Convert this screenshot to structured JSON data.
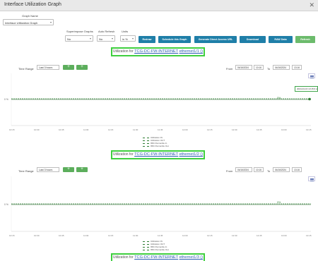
{
  "window": {
    "title": "Interface Utilization Graph",
    "close_glyph": "✕"
  },
  "controls": {
    "graph_name_label": "Graph Name",
    "graph_name_value": "Interface Utilization Graph",
    "superimpose_label": "Superimpose Graphs",
    "superimpose_value": "No",
    "autorefresh_label": "Auto Refresh",
    "autorefresh_value": "No",
    "units_label": "Units",
    "units_value": "in %",
    "buttons": {
      "redraw": "Redraw",
      "schedule": "Schedule this Graph",
      "direct_url": "Generate Direct Access URL",
      "download": "Download",
      "raw_data": "RAW Data",
      "refresh": "Refresh"
    }
  },
  "graphs": [
    {
      "title_prefix": "Utilization for",
      "device": "TCG-DC-FW-INTERNET",
      "separator": "",
      "interface": "ethernet1/1 ()",
      "time_range_label": "Time Range",
      "time_range_value": "Last 3 hours",
      "from_label": "From",
      "to_label": "To",
      "from_date": "04/16/2024",
      "from_time": "10:16",
      "to_date": "04/16/2024",
      "to_time": "13:16",
      "y_label": "0 %",
      "end_label": "0%",
      "tooltip": "2024-04-16 13:15:0 ● 95th Percentile Out: 0%"
    },
    {
      "title_prefix": "Utilization for",
      "device": "TCG-DC-FW-INTERNET",
      "separator": "",
      "interface": "ethernet1/2 ()",
      "time_range_label": "Time Range",
      "time_range_value": "Last 3 hours",
      "from_label": "From",
      "to_label": "To",
      "from_date": "04/16/2024",
      "from_time": "10:16",
      "to_date": "04/16/2024",
      "to_time": "13:16",
      "y_label": "0 %",
      "end_label": "0%"
    },
    {
      "title_prefix": "Utilization for",
      "device": "TCG-DC-FW-INTERNET",
      "separator": "",
      "interface": "ethernet1/3 ()"
    }
  ],
  "x_ticks": [
    "10:15",
    "10:30",
    "10:45",
    "11:00",
    "11:15",
    "11:30",
    "11:45",
    "12:00",
    "12:15",
    "12:30",
    "12:45",
    "13:00",
    "13:15"
  ],
  "legend": [
    "Utilization IN",
    "Utilization OUT",
    "95th Percentile In",
    "95th Percentile Out"
  ],
  "colors": {
    "accent": "#1f7fa8",
    "green_btn": "#6cbb6c",
    "highlight": "#3fcf3f",
    "line": "#2e7d32"
  }
}
